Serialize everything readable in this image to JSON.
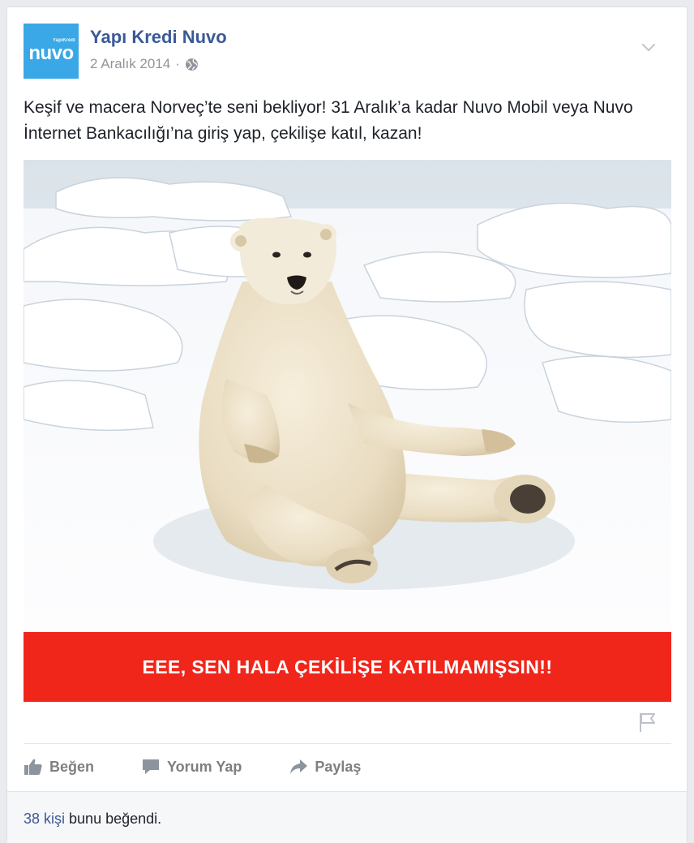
{
  "post": {
    "page_name": "Yapı Kredi Nuvo",
    "avatar": {
      "brand_text": "nuvo",
      "small_text": "YapıKredi",
      "color": "#3aa8e6"
    },
    "date": "2 Aralık 2014",
    "separator": "·",
    "privacy_icon": "globe-icon",
    "menu_icon": "chevron-down-icon",
    "text": "Keşif ve macera Norveç’te seni bekliyor! 31 Aralık’a kadar Nuvo Mobil veya Nuvo İnternet Bankacılığı’na giriş yap, çekilişe katıl, kazan!",
    "image_banner_text": "EEE, SEN HALA ÇEKİLİŞE KATILMAMIŞSIN!!",
    "banner_color": "#f0261b",
    "report_icon": "flag-icon"
  },
  "actions": [
    {
      "label": "Beğen",
      "icon": "thumbs-up-icon"
    },
    {
      "label": "Yorum Yap",
      "icon": "comment-icon"
    },
    {
      "label": "Paylaş",
      "icon": "share-icon"
    }
  ],
  "likes": {
    "count_link": "38 kişi",
    "suffix": " bunu beğendi."
  }
}
